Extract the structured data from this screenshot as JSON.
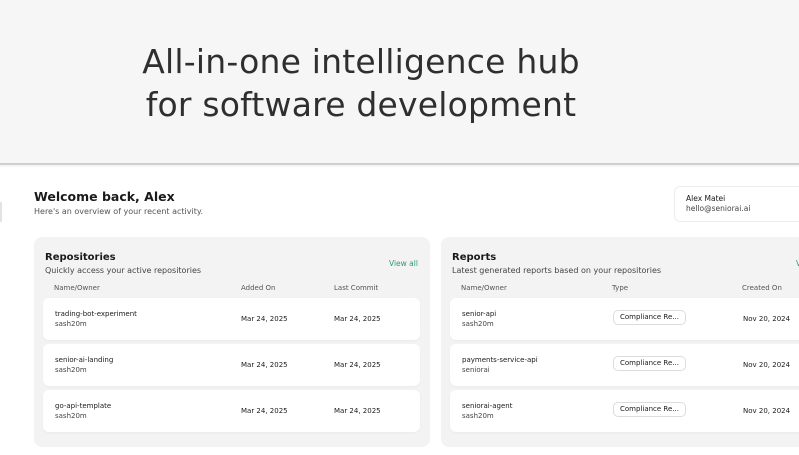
{
  "hero": {
    "line1": "All-in-one intelligence hub",
    "line2": "for software development"
  },
  "welcome": {
    "title": "Welcome back, Alex",
    "subtitle": "Here's an overview of your recent activity."
  },
  "user": {
    "name": "Alex Matei",
    "email": "hello@seniorai.ai"
  },
  "repositories": {
    "title": "Repositories",
    "subtitle": "Quickly access your active repositories",
    "view_all": "View all",
    "columns": [
      "Name/Owner",
      "Added On",
      "Last Commit"
    ],
    "rows": [
      {
        "name": "trading-bot-experiment",
        "owner": "sash20m",
        "added": "Mar 24, 2025",
        "last_commit": "Mar 24, 2025"
      },
      {
        "name": "senior-ai-landing",
        "owner": "sash20m",
        "added": "Mar 24, 2025",
        "last_commit": "Mar 24, 2025"
      },
      {
        "name": "go-api-template",
        "owner": "sash20m",
        "added": "Mar 24, 2025",
        "last_commit": "Mar 24, 2025"
      }
    ]
  },
  "reports": {
    "title": "Reports",
    "subtitle": "Latest generated reports based on your repositories",
    "view_all": "V",
    "columns": [
      "Name/Owner",
      "Type",
      "Created On"
    ],
    "rows": [
      {
        "name": "senior-api",
        "owner": "sash20m",
        "type": "Compliance Re...",
        "created": "Nov 20, 2024"
      },
      {
        "name": "payments-service-api",
        "owner": "seniorai",
        "type": "Compliance Re...",
        "created": "Nov 20, 2024"
      },
      {
        "name": "seniorai-agent",
        "owner": "sash20m",
        "type": "Compliance Re...",
        "created": "Nov 20, 2024"
      }
    ]
  },
  "colors": {
    "accent": "#2e9b6e",
    "hero_bg": "#f6f6f6",
    "panel_bg": "#f3f3f3"
  }
}
